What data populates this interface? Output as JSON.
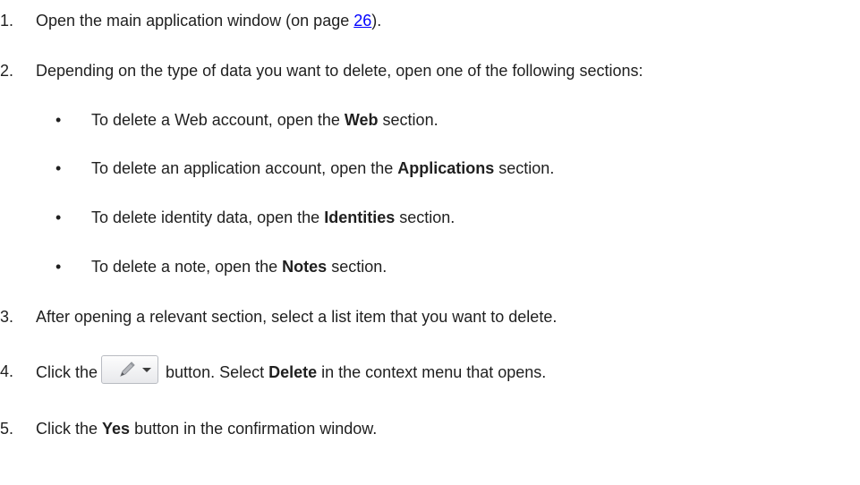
{
  "steps": [
    {
      "number": "1.",
      "text_before": "Open the main application window (on page ",
      "link": "26",
      "text_after": ")."
    },
    {
      "number": "2.",
      "text": "Depending on the type of data you want to delete, open one of the following sections:"
    },
    {
      "number": "3.",
      "text": "After opening a relevant section, select a list item that you want to delete."
    },
    {
      "number": "4.",
      "text_before": "Click the",
      "text_mid": "button. Select ",
      "bold": "Delete",
      "text_after": " in the context menu that opens.",
      "button_icon": "edit-pencil-dropdown-icon"
    },
    {
      "number": "5.",
      "text_before": "Click the ",
      "bold": "Yes",
      "text_after": " button in the confirmation window."
    }
  ],
  "bullets": [
    {
      "before": "To delete a Web account, open the ",
      "bold": "Web",
      "after": " section."
    },
    {
      "before": "To delete an application account, open the ",
      "bold": "Applications",
      "after": " section."
    },
    {
      "before": "To delete identity data, open the ",
      "bold": "Identities",
      "after": " section."
    },
    {
      "before": "To delete a note, open the ",
      "bold": "Notes",
      "after": " section."
    }
  ],
  "bullet_char": "•",
  "colors": {
    "link": "#0000ff",
    "text": "#1f1f1f"
  }
}
